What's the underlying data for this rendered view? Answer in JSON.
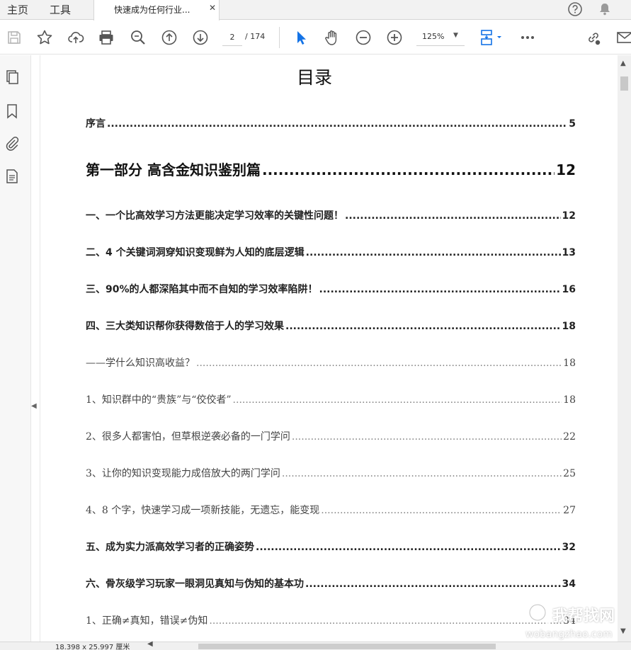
{
  "menu": {
    "home": "主页",
    "tools": "工具"
  },
  "tab": {
    "title": "快速成为任何行业...",
    "close": "✕"
  },
  "toolbar": {
    "page_current": "2",
    "page_total": "/ 174",
    "zoom": "125%",
    "zoom_caret": "▼"
  },
  "document": {
    "title": "目录",
    "toc": [
      {
        "title": "序言",
        "page": "5",
        "style": "bold"
      },
      {
        "title": "第一部分  高含金知识鉴别篇",
        "page": "12",
        "style": "part"
      },
      {
        "title": "一、一个比高效学习方法更能决定学习效率的关键性问题！",
        "page": "12",
        "style": "bold"
      },
      {
        "title": "二、4 个关键词洞穿知识变现鲜为人知的底层逻辑",
        "page": "13",
        "style": "bold"
      },
      {
        "title": "三、90%的人都深陷其中而不自知的学习效率陷阱！",
        "page": "16",
        "style": "bold"
      },
      {
        "title": "四、三大类知识帮你获得数倍于人的学习效果",
        "page": "18",
        "style": "bold"
      },
      {
        "title": "——学什么知识高收益？",
        "page": "18",
        "style": "normal"
      },
      {
        "title": "1、知识群中的“贵族”与“佼佼者”",
        "page": "18",
        "style": "normal"
      },
      {
        "title": "2、很多人都害怕，但草根逆袭必备的一门学问",
        "page": "22",
        "style": "normal"
      },
      {
        "title": "3、让你的知识变现能力成倍放大的两门学问",
        "page": "25",
        "style": "normal"
      },
      {
        "title": "4、8 个字，快速学习成一项新技能，无遗忘，能变现",
        "page": "27",
        "style": "normal"
      },
      {
        "title": "五、成为实力派高效学习者的正确姿势",
        "page": "32",
        "style": "bold"
      },
      {
        "title": "六、骨灰级学习玩家一眼洞见真知与伪知的基本功",
        "page": "34",
        "style": "bold"
      },
      {
        "title": "1、正确≠真知，错误≠伪知",
        "page": "34",
        "style": "normal"
      }
    ]
  },
  "status": {
    "page_size": "18.398 x 25.997 厘米"
  },
  "watermark": {
    "cn": "我帮找网",
    "en": "wobangzhao.com"
  },
  "colors": {
    "accent_blue": "#1473e6",
    "icon_gray": "#555555",
    "disabled_gray": "#b5b5b5"
  }
}
